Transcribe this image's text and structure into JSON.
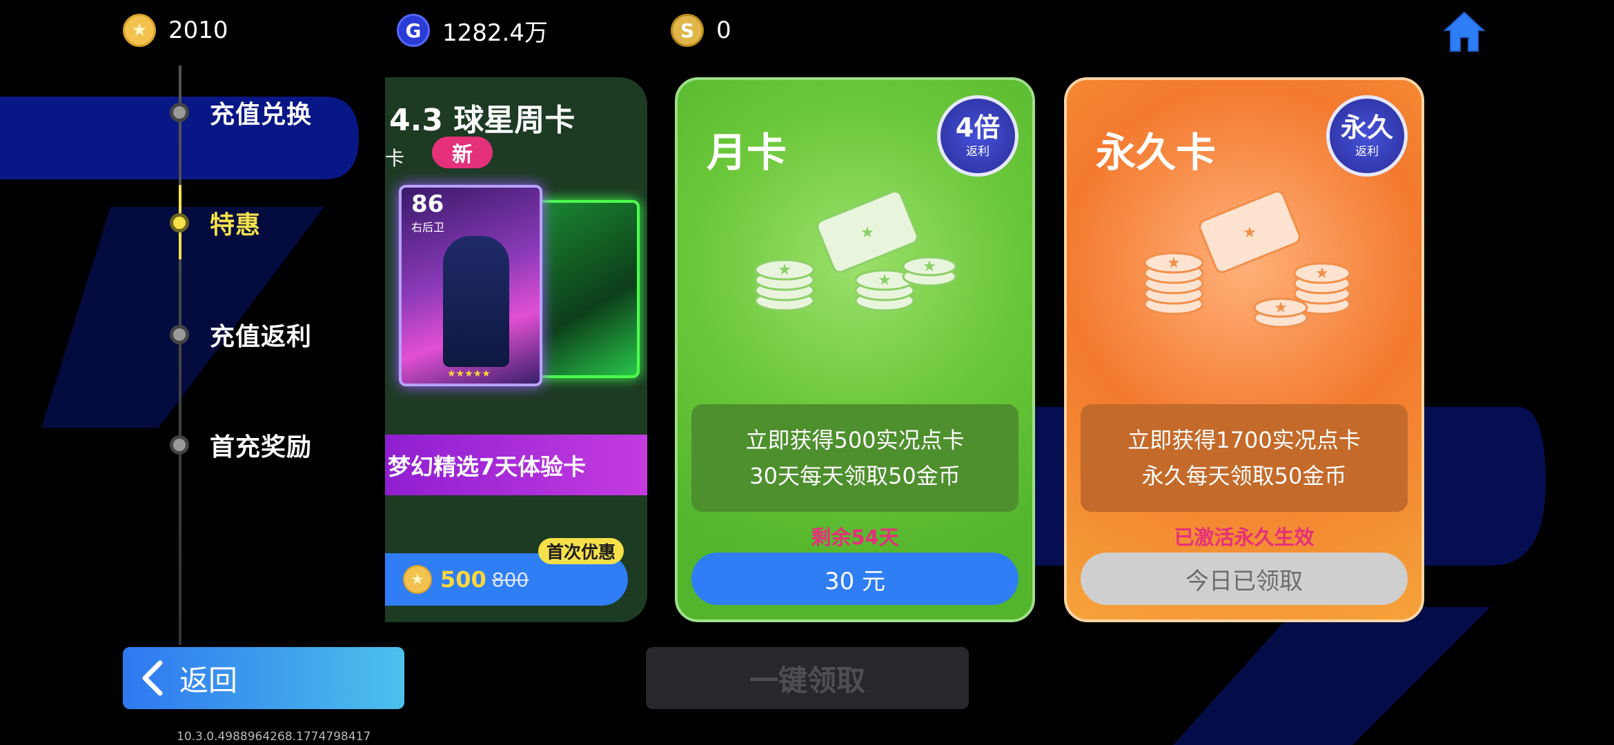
{
  "currencies": [
    {
      "icon": "star-coin-icon",
      "value": "2010"
    },
    {
      "icon": "g-coin-icon",
      "value": "1282.4万"
    },
    {
      "icon": "s-coin-icon",
      "value": "0"
    }
  ],
  "sidebar": {
    "items": [
      {
        "label": "充值兑换",
        "active": false
      },
      {
        "label": "特惠",
        "active": true
      },
      {
        "label": "充值返利",
        "active": false
      },
      {
        "label": "首充奖励",
        "active": false
      }
    ]
  },
  "week_card": {
    "title": "4.3 球星周卡",
    "subtitle": "卡",
    "new_badge": "新",
    "player_rating": "86",
    "player_position": "右后卫",
    "trial_banner": "梦幻精选7天体验卡",
    "first_badge": "首次优惠",
    "price_now": "500",
    "price_old": "800"
  },
  "month_card": {
    "title": "月卡",
    "multiplier": "4倍",
    "multiplier_sub": "返利",
    "benefit_line1": "立即获得500实况点卡",
    "benefit_line2": "30天每天领取50金币",
    "status": "剩余54天",
    "button": "30 元"
  },
  "perm_card": {
    "title": "永久卡",
    "multiplier": "永久",
    "multiplier_sub": "返利",
    "benefit_line1": "立即获得1700实况点卡",
    "benefit_line2": "永久每天领取50金币",
    "status": "已激活永久生效",
    "button": "今日已领取"
  },
  "footer": {
    "back_label": "返回",
    "claim_all": "一键领取",
    "version": "10.3.0.4988964268.1774798417"
  },
  "colors": {
    "accent_yellow": "#f5e14a",
    "primary_blue": "#2f7ef5",
    "status_pink": "#e5307a"
  }
}
